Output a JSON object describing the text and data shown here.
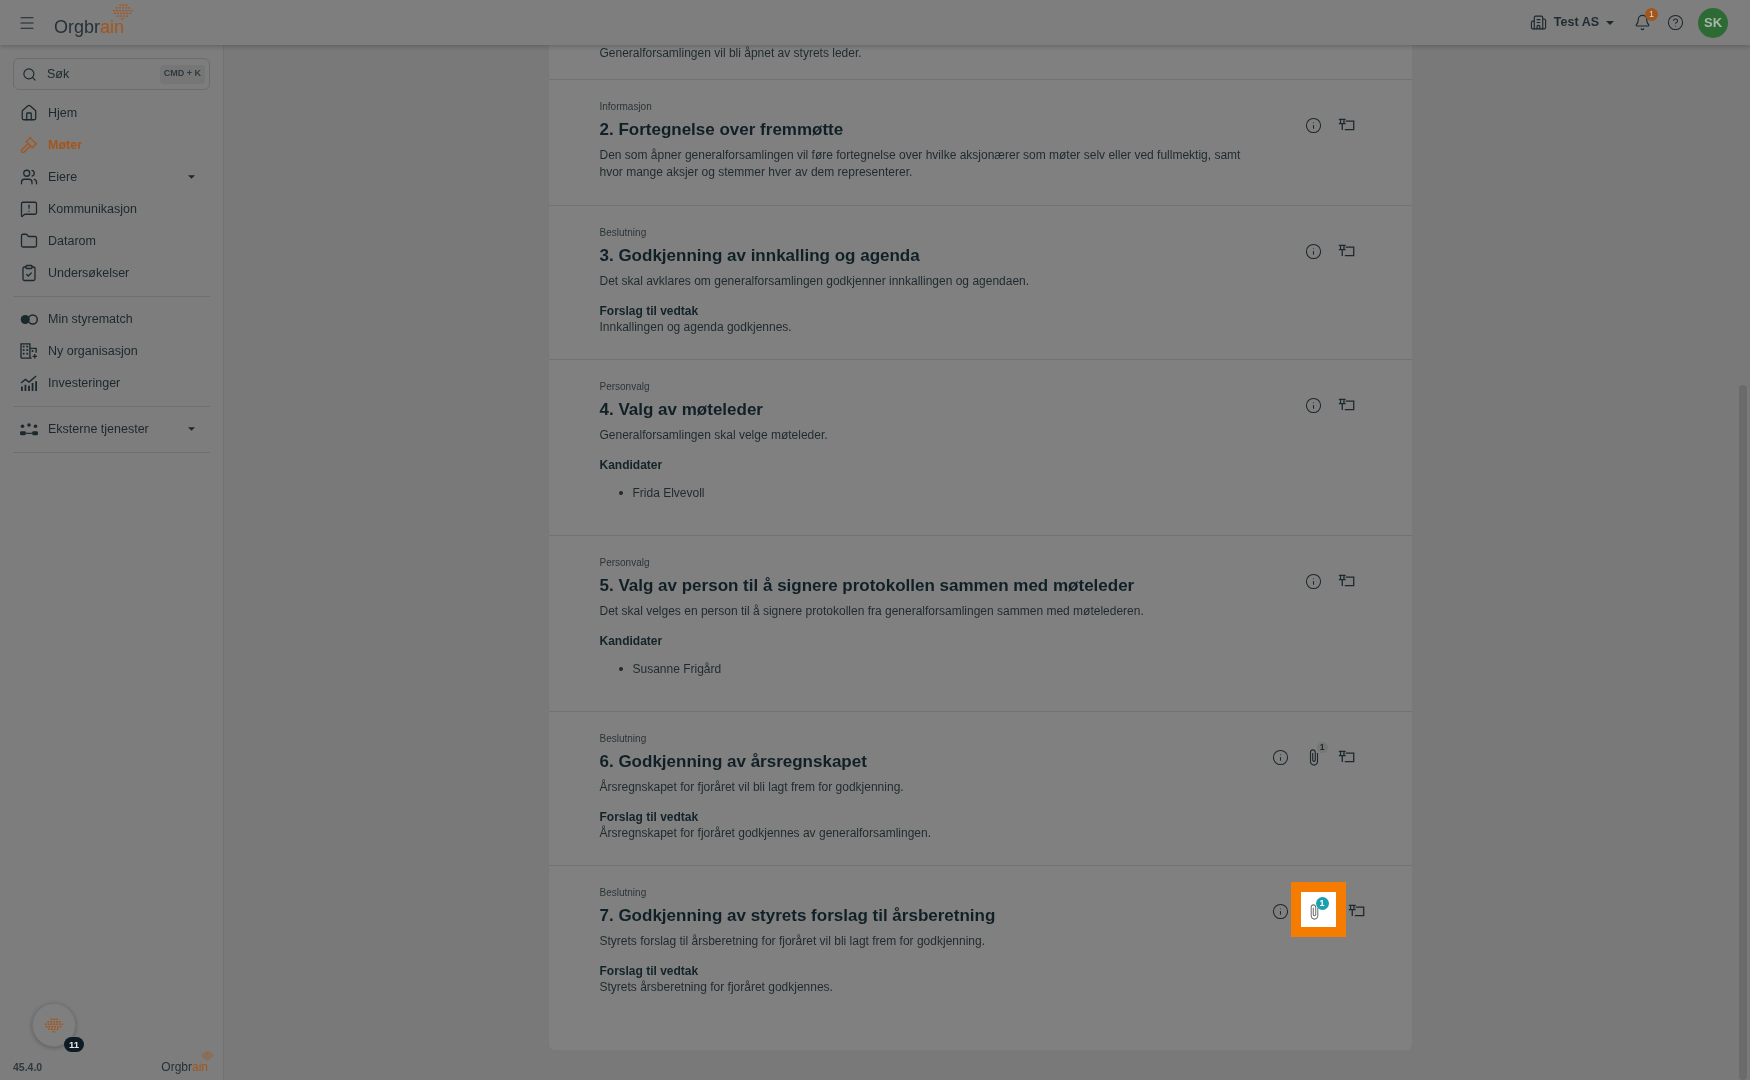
{
  "header": {
    "logo": {
      "text": "Orgbr",
      "accent": "ain"
    },
    "organization": {
      "name": "Test AS"
    },
    "notifications": {
      "count": "1"
    },
    "avatar": {
      "initials": "SK"
    }
  },
  "sidebar": {
    "search": {
      "placeholder": "Søk",
      "shortcut": "CMD + K"
    },
    "groups": [
      [
        {
          "label": "Hjem",
          "kind": "link",
          "selected": false
        },
        {
          "label": "Møter",
          "kind": "link",
          "selected": true
        },
        {
          "label": "Eiere",
          "kind": "menu",
          "expanded": false,
          "selected": false
        },
        {
          "label": "Kommunikasjon",
          "kind": "link",
          "selected": false
        },
        {
          "label": "Datarom",
          "kind": "link",
          "selected": false
        },
        {
          "label": "Undersøkelser",
          "kind": "link",
          "selected": false
        }
      ],
      [
        {
          "label": "Min styrematch",
          "kind": "link",
          "selected": false
        },
        {
          "label": "Ny organisasjon",
          "kind": "link",
          "selected": false
        },
        {
          "label": "Investeringer",
          "kind": "link",
          "selected": false
        }
      ],
      [
        {
          "label": "Eksterne tjenester",
          "kind": "menu",
          "expanded": false,
          "selected": false
        }
      ]
    ],
    "assistant": {
      "badge": "11"
    },
    "version": "45.4.0",
    "footer_logo": {
      "text": "Orgbr",
      "accent": "ain"
    }
  },
  "agenda": {
    "items": [
      {
        "description": "Generalforsamlingen vil bli åpnet av styrets leder."
      },
      {
        "type": "Informasjon",
        "title": "2. Fortegnelse over fremmøtte",
        "description": "Den som åpner generalforsamlingen vil føre fortegnelse over hvilke aksjonærer som møter selv eller ved fullmektig, samt hvor mange aksjer og stemmer hver av dem representerer."
      },
      {
        "type": "Beslutning",
        "title": "3. Godkjenning av innkalling og agenda",
        "description": "Det skal avklares om generalforsamlingen godkjenner innkallingen og agendaen.",
        "section": {
          "kind": "paragraph",
          "heading": "Forslag til vedtak",
          "text": "Innkallingen og agenda godkjennes."
        }
      },
      {
        "type": "Personvalg",
        "title": "4. Valg av møteleder",
        "description": "Generalforsamlingen skal velge møteleder.",
        "section": {
          "kind": "list",
          "heading": "Kandidater",
          "entries": [
            "Frida Elvevoll"
          ]
        }
      },
      {
        "type": "Personvalg",
        "title": "5. Valg av person til å signere protokollen sammen med møteleder",
        "description": "Det skal velges en person til å signere protokollen fra generalforsamlingen sammen med møtelederen.",
        "section": {
          "kind": "list",
          "heading": "Kandidater",
          "entries": [
            "Susanne Frigård"
          ]
        }
      },
      {
        "type": "Beslutning",
        "title": "6. Godkjenning av årsregnskapet",
        "description": "Årsregnskapet for fjoråret vil bli lagt frem for godkjenning.",
        "section": {
          "kind": "paragraph",
          "heading": "Forslag til vedtak",
          "text": "Årsregnskapet for fjoråret godkjennes av generalforsamlingen."
        },
        "attachment": {
          "count": "1",
          "highlighted": false
        }
      },
      {
        "type": "Beslutning",
        "title": "7. Godkjenning av styrets forslag til årsberetning",
        "description": "Styrets forslag til årsberetning for fjoråret vil bli lagt frem for godkjenning.",
        "section": {
          "kind": "paragraph",
          "heading": "Forslag til vedtak",
          "text": "Styrets årsberetning for fjoråret godkjennes."
        },
        "attachment": {
          "count": "1",
          "highlighted": true
        }
      }
    ]
  }
}
